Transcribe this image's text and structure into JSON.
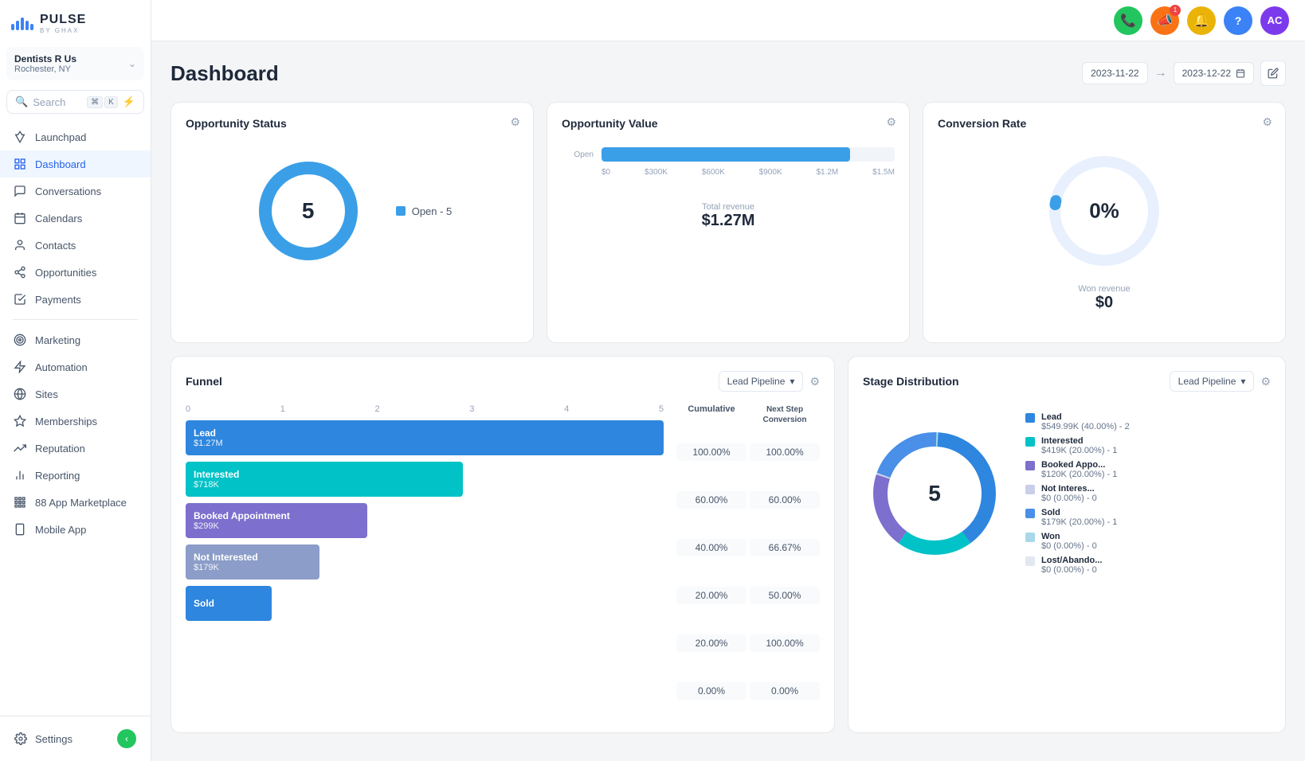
{
  "app": {
    "logo_title": "PULSE",
    "logo_sub": "BY GHAX"
  },
  "account": {
    "name": "Dentists R Us",
    "location": "Rochester, NY"
  },
  "search": {
    "placeholder": "Search",
    "shortcut_key": "⌘",
    "shortcut_k": "K"
  },
  "sidebar": {
    "items": [
      {
        "id": "launchpad",
        "label": "Launchpad",
        "icon": "rocket"
      },
      {
        "id": "dashboard",
        "label": "Dashboard",
        "icon": "grid",
        "active": true
      },
      {
        "id": "conversations",
        "label": "Conversations",
        "icon": "chat"
      },
      {
        "id": "calendars",
        "label": "Calendars",
        "icon": "calendar"
      },
      {
        "id": "contacts",
        "label": "Contacts",
        "icon": "user"
      },
      {
        "id": "opportunities",
        "label": "Opportunities",
        "icon": "node"
      },
      {
        "id": "payments",
        "label": "Payments",
        "icon": "receipt"
      }
    ],
    "items2": [
      {
        "id": "marketing",
        "label": "Marketing",
        "icon": "target"
      },
      {
        "id": "automation",
        "label": "Automation",
        "icon": "bolt"
      },
      {
        "id": "sites",
        "label": "Sites",
        "icon": "globe"
      },
      {
        "id": "memberships",
        "label": "Memberships",
        "icon": "star"
      },
      {
        "id": "reputation",
        "label": "Reputation",
        "icon": "trending"
      },
      {
        "id": "reporting",
        "label": "Reporting",
        "icon": "chart"
      },
      {
        "id": "app-marketplace",
        "label": "88 App Marketplace",
        "icon": "apps"
      },
      {
        "id": "mobile-app",
        "label": "Mobile App",
        "icon": "phone"
      }
    ],
    "settings_label": "Settings"
  },
  "topbar": {
    "phone_icon": "📞",
    "megaphone_icon": "📣",
    "bell_icon": "🔔",
    "help_icon": "?",
    "avatar_initials": "AC",
    "notification_count": "1"
  },
  "header": {
    "title": "Dashboard",
    "date_from": "2023-11-22",
    "date_to": "2023-12-22"
  },
  "opportunity_status": {
    "title": "Opportunity Status",
    "value": 5,
    "segments": [
      {
        "label": "Open",
        "count": 5,
        "color": "#3b9fe8",
        "percent": 100
      }
    ],
    "legend": [
      {
        "label": "Open - 5",
        "color": "#3b9fe8"
      }
    ]
  },
  "opportunity_value": {
    "title": "Opportunity Value",
    "bars": [
      {
        "label": "Open",
        "value": 1270000,
        "max": 1500000,
        "color": "#3b9fe8"
      }
    ],
    "x_labels": [
      "$0",
      "$300K",
      "$600K",
      "$900K",
      "$1.2M",
      "$1.5M"
    ],
    "total_revenue_label": "Total revenue",
    "total_revenue": "$1.27M"
  },
  "conversion_rate": {
    "title": "Conversion Rate",
    "percent": "0%",
    "won_revenue_label": "Won revenue",
    "won_revenue": "$0"
  },
  "funnel": {
    "title": "Funnel",
    "pipeline": "Lead Pipeline",
    "x_labels": [
      "0",
      "1",
      "2",
      "3",
      "4",
      "5"
    ],
    "bars": [
      {
        "name": "Lead",
        "value": "$1.27M",
        "color": "#2e86de",
        "width_pct": 100
      },
      {
        "name": "Interested",
        "value": "$718K",
        "color": "#00c2c7",
        "width_pct": 58
      },
      {
        "name": "Booked Appointment",
        "value": "$299K",
        "color": "#7c6fcd",
        "width_pct": 38
      },
      {
        "name": "Not Interested",
        "value": "$179K",
        "color": "#8b9dc8",
        "width_pct": 28
      },
      {
        "name": "Sold",
        "value": "",
        "color": "#2e86de",
        "width_pct": 18
      }
    ],
    "table_headers": [
      "Cumulative",
      "Next Step Conversion"
    ],
    "table_rows": [
      {
        "cumulative": "100.00%",
        "next_step": "100.00%"
      },
      {
        "cumulative": "60.00%",
        "next_step": "60.00%"
      },
      {
        "cumulative": "40.00%",
        "next_step": "66.67%"
      },
      {
        "cumulative": "20.00%",
        "next_step": "50.00%"
      },
      {
        "cumulative": "20.00%",
        "next_step": "100.00%"
      },
      {
        "cumulative": "0.00%",
        "next_step": "0.00%"
      }
    ]
  },
  "stage_distribution": {
    "title": "Stage Distribution",
    "pipeline": "Lead Pipeline",
    "total": 5,
    "segments": [
      {
        "label": "Lead",
        "color": "#2e86de",
        "pct": 40,
        "degrees": 144
      },
      {
        "label": "Interested",
        "color": "#00c2c7",
        "pct": 20,
        "degrees": 72
      },
      {
        "label": "Booked Appo...",
        "color": "#7c6fcd",
        "pct": 20,
        "degrees": 72
      },
      {
        "label": "Not Interes...",
        "color": "#c9cfe8",
        "pct": 0,
        "degrees": 1
      },
      {
        "label": "Sold",
        "color": "#4a8fe8",
        "pct": 20,
        "degrees": 72
      },
      {
        "label": "Won",
        "color": "#a8d8ea",
        "pct": 0,
        "degrees": 1
      }
    ],
    "legend": [
      {
        "name": "Lead",
        "detail": "$549.99K (40.00%) - 2",
        "color": "#2e86de"
      },
      {
        "name": "Interested",
        "detail": "$419K (20.00%) - 1",
        "color": "#00c2c7"
      },
      {
        "name": "Booked Appo...",
        "detail": "$120K (20.00%) - 1",
        "color": "#7c6fcd"
      },
      {
        "name": "Not Interes...",
        "detail": "$0 (0.00%) - 0",
        "color": "#c9cfe8"
      },
      {
        "name": "Sold",
        "detail": "$179K (20.00%) - 1",
        "color": "#4a8fe8"
      },
      {
        "name": "Won",
        "detail": "$0 (0.00%) - 0",
        "color": "#a8d8ea"
      },
      {
        "name": "Lost/Abando...",
        "detail": "$0 (0.00%) - 0",
        "color": "#e2e8f0"
      }
    ]
  }
}
